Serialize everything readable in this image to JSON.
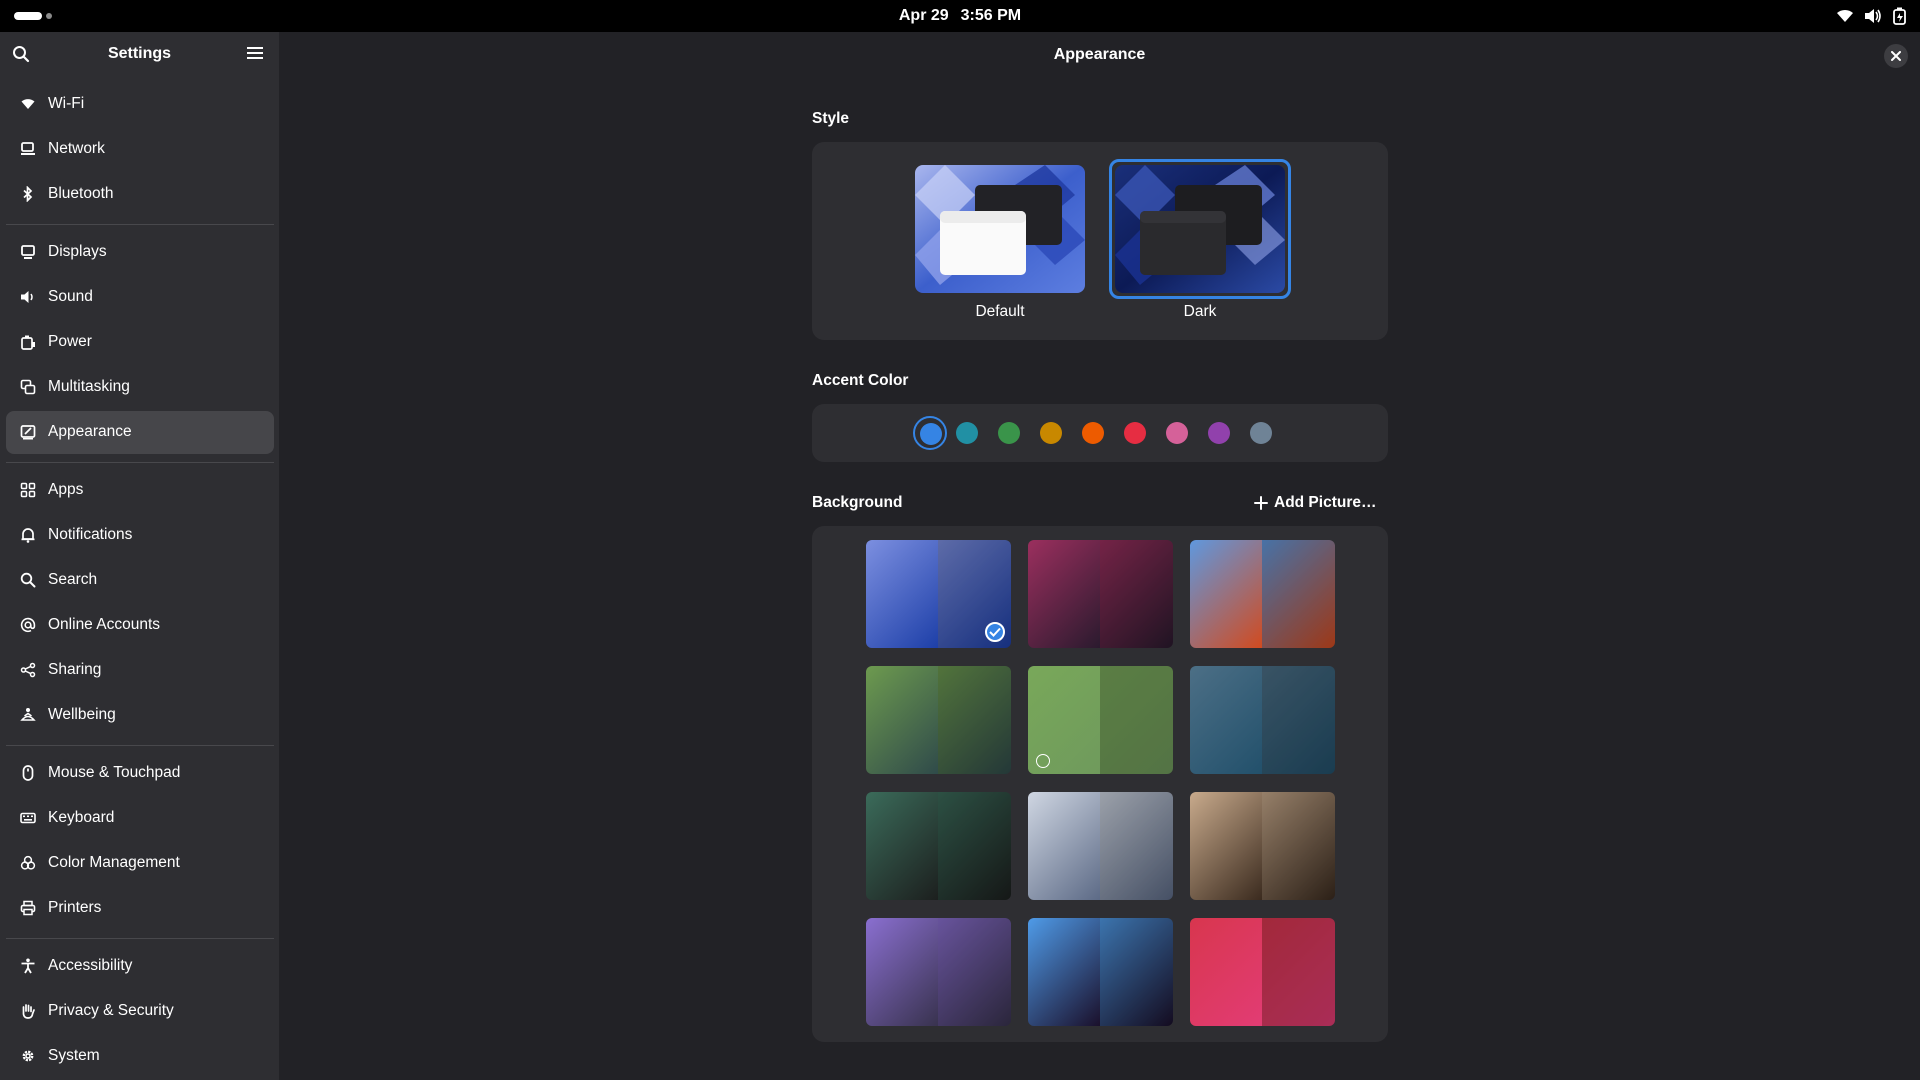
{
  "topbar": {
    "date": "Apr 29",
    "time": "3:56 PM",
    "tray_icons": [
      "wifi-icon",
      "volume-icon",
      "battery-icon"
    ]
  },
  "sidebar": {
    "title": "Settings",
    "items": [
      {
        "label": "Wi-Fi",
        "icon": "wifi-icon"
      },
      {
        "label": "Network",
        "icon": "network-icon"
      },
      {
        "label": "Bluetooth",
        "icon": "bluetooth-icon"
      },
      {
        "label": "Displays",
        "icon": "display-icon"
      },
      {
        "label": "Sound",
        "icon": "speaker-icon"
      },
      {
        "label": "Power",
        "icon": "battery-icon"
      },
      {
        "label": "Multitasking",
        "icon": "multitasking-icon"
      },
      {
        "label": "Appearance",
        "icon": "appearance-icon",
        "active": true
      },
      {
        "label": "Apps",
        "icon": "apps-grid-icon"
      },
      {
        "label": "Notifications",
        "icon": "bell-icon"
      },
      {
        "label": "Search",
        "icon": "search-icon"
      },
      {
        "label": "Online Accounts",
        "icon": "at-sign-icon"
      },
      {
        "label": "Sharing",
        "icon": "share-icon"
      },
      {
        "label": "Wellbeing",
        "icon": "wellbeing-icon"
      },
      {
        "label": "Mouse & Touchpad",
        "icon": "mouse-icon"
      },
      {
        "label": "Keyboard",
        "icon": "keyboard-icon"
      },
      {
        "label": "Color Management",
        "icon": "color-icon"
      },
      {
        "label": "Printers",
        "icon": "printer-icon"
      },
      {
        "label": "Accessibility",
        "icon": "accessibility-icon"
      },
      {
        "label": "Privacy & Security",
        "icon": "hand-icon"
      },
      {
        "label": "System",
        "icon": "gear-icon"
      }
    ]
  },
  "main": {
    "title": "Appearance",
    "style": {
      "heading": "Style",
      "options": [
        {
          "label": "Default",
          "selected": false
        },
        {
          "label": "Dark",
          "selected": true
        }
      ]
    },
    "accent": {
      "heading": "Accent Color",
      "colors": [
        "#3584e4",
        "#2190a4",
        "#3a944a",
        "#c88800",
        "#ed5b00",
        "#e62d42",
        "#d56199",
        "#9141ac",
        "#6f8396"
      ],
      "selected_index": 0
    },
    "background": {
      "heading": "Background",
      "add_label": "Add Picture…",
      "thumbnails": [
        {
          "name": "blue-crystal-wallpaper",
          "colors": [
            "#7c8fe0",
            "#1d3fa8"
          ],
          "selected": true
        },
        {
          "name": "sunset-waves-wallpaper",
          "colors": [
            "#9b2f5e",
            "#2a1a2e"
          ],
          "selected": false
        },
        {
          "name": "blue-orange-drip-wallpaper",
          "colors": [
            "#5f98de",
            "#d24a1e"
          ],
          "selected": false
        },
        {
          "name": "tree-landscape-wallpaper",
          "colors": [
            "#6d9a4f",
            "#2f4a4a"
          ],
          "selected": false
        },
        {
          "name": "tree-landscape-light-wallpaper",
          "colors": [
            "#79a85a",
            "#6f9a5c"
          ],
          "selected": false,
          "hover_check": true
        },
        {
          "name": "blue-swirl-wallpaper",
          "colors": [
            "#4c6f86",
            "#22506b"
          ],
          "selected": false
        },
        {
          "name": "green-glass-wallpaper",
          "colors": [
            "#3b6b5a",
            "#1c1f1e"
          ],
          "selected": false
        },
        {
          "name": "grey-silk-wallpaper",
          "colors": [
            "#cfd6e2",
            "#5c6a86"
          ],
          "selected": false
        },
        {
          "name": "amber-ripple-wallpaper",
          "colors": [
            "#c8aa8c",
            "#3a2a1e"
          ],
          "selected": false
        },
        {
          "name": "purple-crystal-wallpaper",
          "colors": [
            "#8a6fd0",
            "#38324e"
          ],
          "selected": false
        },
        {
          "name": "blue-purple-wave-wallpaper",
          "colors": [
            "#4f9be8",
            "#1a0f2a"
          ],
          "selected": false
        },
        {
          "name": "pink-pills-wallpaper",
          "colors": [
            "#d8364e",
            "#e23c74"
          ],
          "selected": false
        }
      ]
    }
  }
}
